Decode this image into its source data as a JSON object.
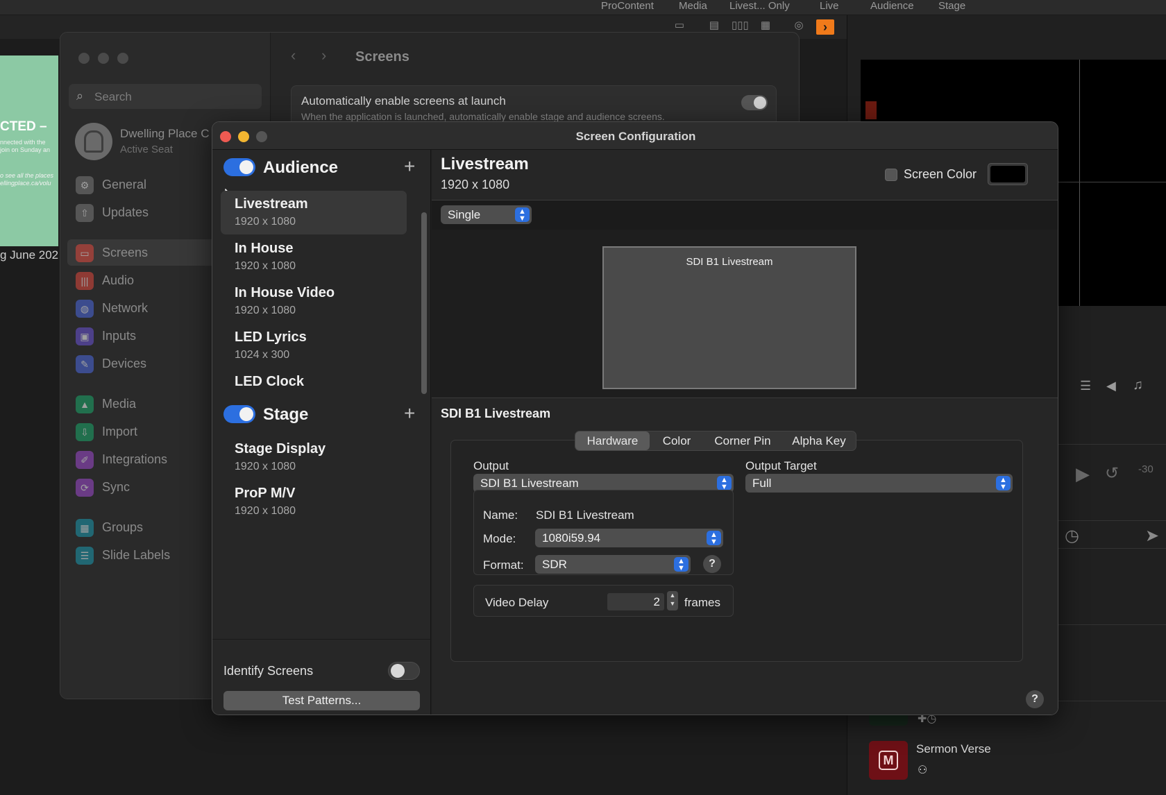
{
  "app": {
    "modes": [
      "ProContent",
      "Media",
      "Livest... Only",
      "Live",
      "Audience",
      "Stage"
    ],
    "thumb": {
      "title": "CTED –",
      "body": "nnected with the\njoin on Sunday an",
      "body2": "o see all the places\nellingplace.ca/volu",
      "caption": "g June 202"
    },
    "sermon_label": "Sermon Verse"
  },
  "settings": {
    "search_placeholder": "Search",
    "user_name": "Dwelling Place C",
    "user_seat": "Active Seat",
    "nav": [
      {
        "label": "General",
        "icon": "gear-icon",
        "color": "#7a7a7a"
      },
      {
        "label": "Updates",
        "icon": "arrow-up-icon",
        "color": "#7a7a7a"
      },
      {
        "label": "Screens",
        "icon": "screens-icon",
        "color": "#e0483d",
        "selected": true
      },
      {
        "label": "Audio",
        "icon": "waveform-icon",
        "color": "#e0483d"
      },
      {
        "label": "Network",
        "icon": "globe-icon",
        "color": "#4b68e0"
      },
      {
        "label": "Inputs",
        "icon": "inputs-icon",
        "color": "#6a52d8"
      },
      {
        "label": "Devices",
        "icon": "devices-icon",
        "color": "#4b68e0"
      },
      {
        "label": "Media",
        "icon": "media-icon",
        "color": "#1aa86a"
      },
      {
        "label": "Import",
        "icon": "import-icon",
        "color": "#1aa86a"
      },
      {
        "label": "Integrations",
        "icon": "integrations-icon",
        "color": "#a04ad0"
      },
      {
        "label": "Sync",
        "icon": "sync-icon",
        "color": "#a04ad0"
      },
      {
        "label": "Groups",
        "icon": "groups-icon",
        "color": "#1a9ab0"
      },
      {
        "label": "Slide Labels",
        "icon": "list-icon",
        "color": "#1a9ab0"
      }
    ],
    "page_title": "Screens",
    "auto_enable": {
      "title": "Automatically enable screens at launch",
      "description": "When the application is launched, automatically enable stage and audience screens."
    }
  },
  "config": {
    "window_title": "Screen Configuration",
    "groups": [
      {
        "label": "Audience",
        "enabled": true,
        "screens": [
          {
            "name": "Livestream",
            "res": "1920 x 1080",
            "selected": true
          },
          {
            "name": "In House",
            "res": "1920 x 1080"
          },
          {
            "name": "In House Video",
            "res": "1920 x 1080"
          },
          {
            "name": "LED Lyrics",
            "res": "1024 x 300"
          },
          {
            "name": "LED Clock",
            "res": ""
          }
        ]
      },
      {
        "label": "Stage",
        "enabled": true,
        "screens": [
          {
            "name": "Stage Display",
            "res": "1920 x 1080"
          },
          {
            "name": "ProP M/V",
            "res": "1920 x 1080"
          }
        ]
      }
    ],
    "identify_label": "Identify Screens",
    "identify_on": false,
    "test_patterns_label": "Test Patterns...",
    "selected": {
      "name": "Livestream",
      "res": "1920 x 1080",
      "screen_color_label": "Screen Color",
      "screen_color": "#000000",
      "arrangement": "Single",
      "output_rect_label": "SDI B1 Livestream",
      "output_title": "SDI B1 Livestream",
      "tabs": [
        "Hardware",
        "Color",
        "Corner Pin",
        "Alpha Key"
      ],
      "active_tab": "Hardware",
      "output_label": "Output",
      "output_value": "SDI B1 Livestream",
      "output_target_label": "Output Target",
      "output_target_value": "Full",
      "name_label": "Name:",
      "name_value": "SDI B1 Livestream",
      "mode_label": "Mode:",
      "mode_value": "1080i59.94",
      "format_label": "Format:",
      "format_value": "SDR",
      "video_delay_label": "Video Delay",
      "video_delay_value": "2",
      "video_delay_unit": "frames"
    }
  },
  "colors": {
    "accent": "#2c6fe0",
    "close": "#ee5a52",
    "minimize": "#f2b531",
    "inactive": "#555555"
  }
}
